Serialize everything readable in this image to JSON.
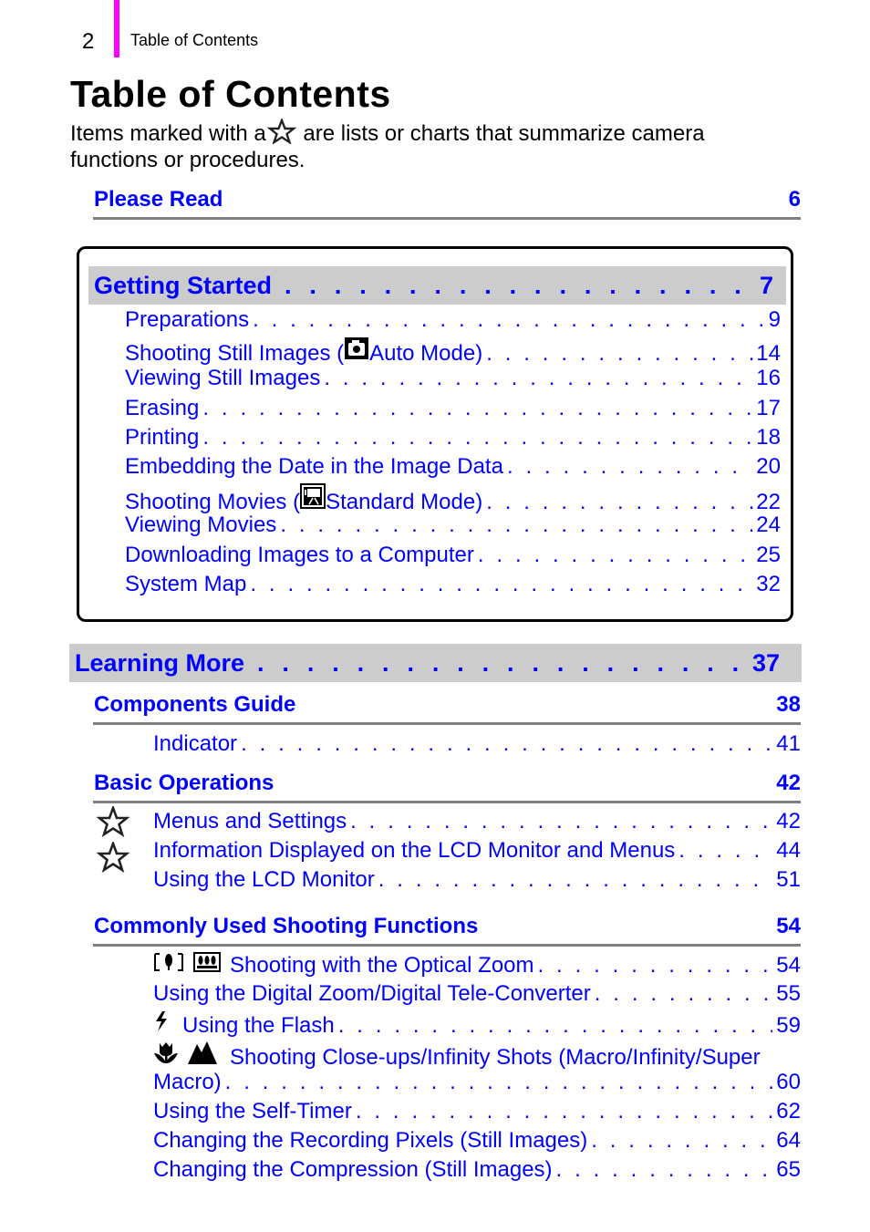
{
  "header": {
    "page_number": "2",
    "section_title": "Table of Contents",
    "accent_color": "#ff00ff"
  },
  "title": "Table of Contents",
  "intro": {
    "before_star": "Items marked with a",
    "after_star": " are lists or charts that summarize camera functions or procedures.",
    "star_icon": "star-outline-icon"
  },
  "colors": {
    "link": "#0000ff",
    "bar_bg": "#cccccc",
    "rule": "#808080"
  },
  "please_read": {
    "label": "Please Read",
    "page": "6"
  },
  "getting_started": {
    "label": "Getting Started",
    "page": "7",
    "items": [
      {
        "text": "Preparations",
        "page": "9"
      },
      {
        "text_before": "Shooting Still Images (",
        "icon": "auto-mode-camera-icon",
        "text_after": " Auto Mode)",
        "page": "14"
      },
      {
        "text": "Viewing Still Images",
        "page": "16"
      },
      {
        "text": "Erasing",
        "page": "17"
      },
      {
        "text": "Printing",
        "page": "18"
      },
      {
        "text": "Embedding the Date in the Image Data",
        "page": "20"
      },
      {
        "text_before": "Shooting Movies (",
        "icon": "movie-mode-icon",
        "text_after": " Standard Mode)",
        "page": "22"
      },
      {
        "text": "Viewing Movies",
        "page": "24"
      },
      {
        "text": "Downloading Images to a Computer",
        "page": "25"
      },
      {
        "text": "System Map",
        "page": "32"
      }
    ]
  },
  "learning_more": {
    "label": "Learning More",
    "page": "37",
    "sections": [
      {
        "label": "Components Guide",
        "page": "38",
        "items": [
          {
            "text": "Indicator",
            "page": "41"
          }
        ]
      },
      {
        "label": "Basic Operations",
        "page": "42",
        "items": [
          {
            "text": "Menus and Settings",
            "page": "42",
            "starred": true
          },
          {
            "text": "Information Displayed on the LCD Monitor and Menus",
            "page": "44",
            "starred": true
          },
          {
            "text": "Using the LCD Monitor",
            "page": "51"
          }
        ]
      },
      {
        "label": "Commonly Used Shooting Functions",
        "page": "54",
        "items": [
          {
            "text": "Shooting with the Optical Zoom",
            "page": "54",
            "icons": [
              "tele-zoom-icon",
              "wide-zoom-icon"
            ]
          },
          {
            "text": "Using the Digital Zoom/Digital Tele-Converter",
            "page": "55"
          },
          {
            "text": "Using the Flash",
            "page": "59",
            "icons": [
              "flash-icon"
            ]
          },
          {
            "text": "Shooting Close-ups/Infinity Shots (Macro/Infinity/Super",
            "text_cont": "Macro)",
            "page": "60",
            "icons": [
              "macro-icon",
              "infinity-icon"
            ]
          },
          {
            "text": "Using the Self-Timer",
            "page": "62"
          },
          {
            "text": "Changing the Recording Pixels (Still Images)",
            "page": "64"
          },
          {
            "text": "Changing the Compression (Still Images)",
            "page": "65"
          }
        ]
      }
    ]
  }
}
